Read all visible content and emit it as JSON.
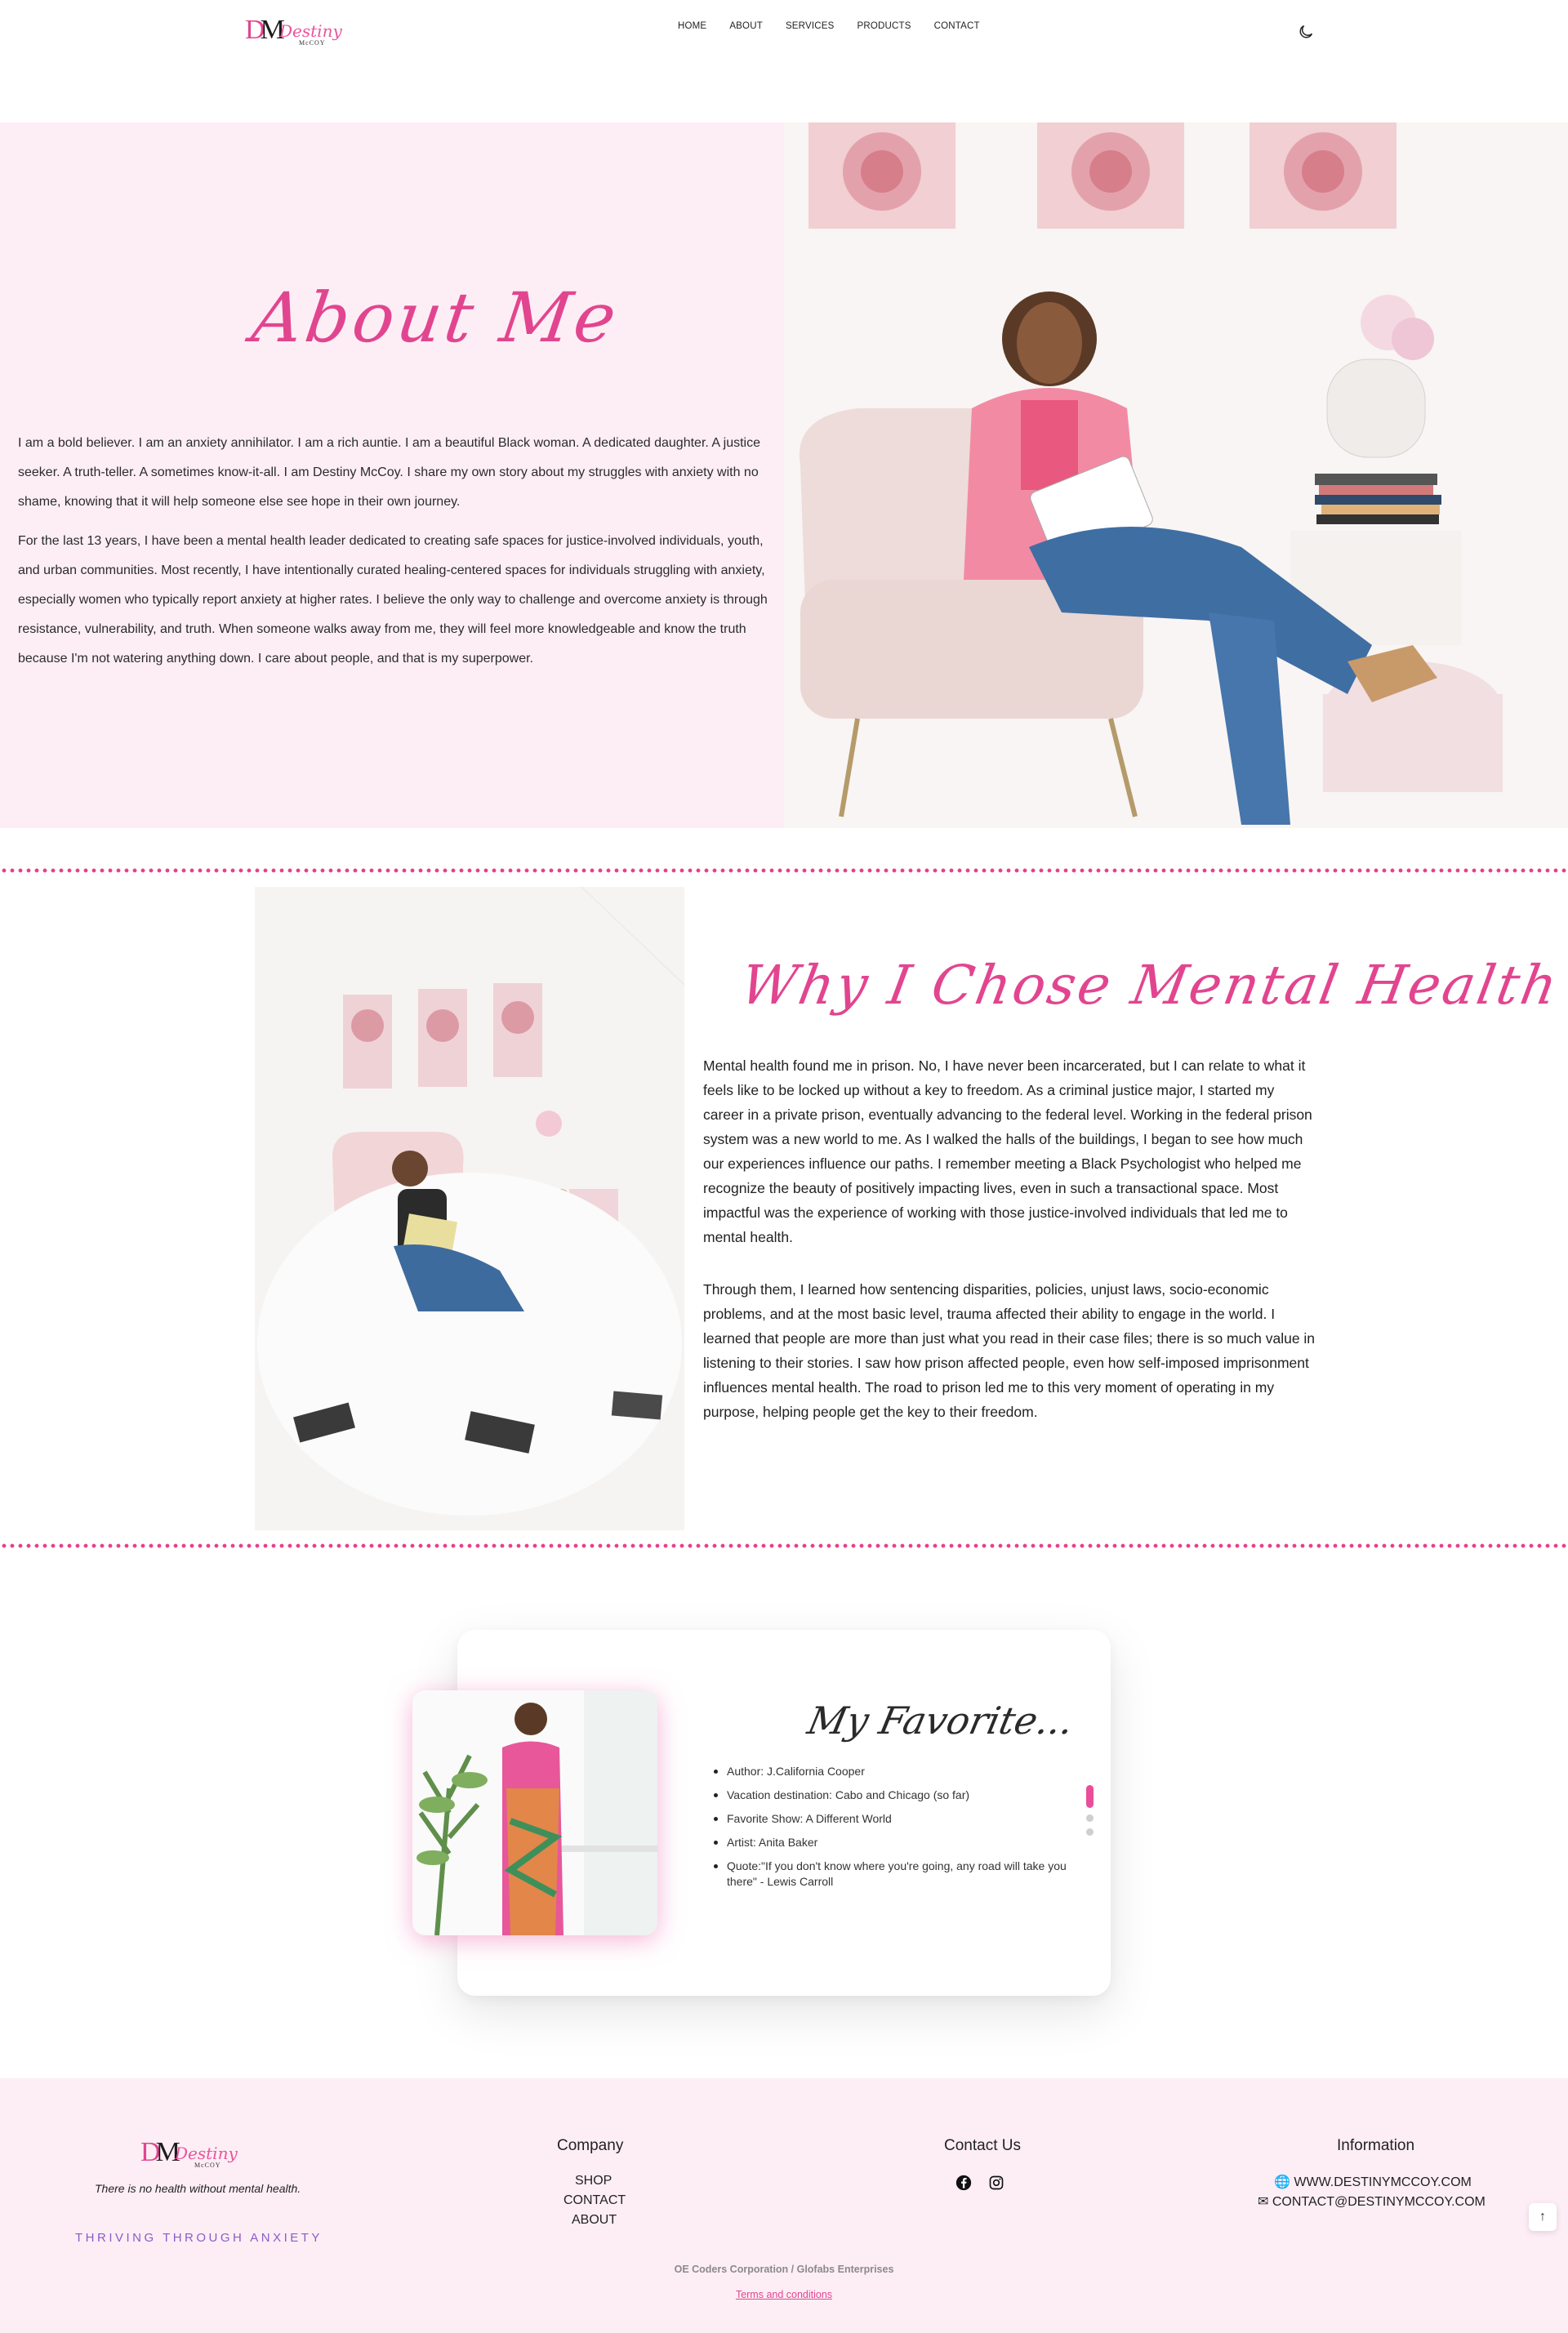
{
  "brand": {
    "monogram": "DM",
    "script_name": "Destiny",
    "sub_name": "McCOY"
  },
  "nav": {
    "items": [
      "HOME",
      "ABOUT",
      "SERVICES",
      "PRODUCTS",
      "CONTACT"
    ]
  },
  "about": {
    "title": "About Me",
    "paragraphs": [
      "I am a bold believer. I am an anxiety annihilator. I am a rich auntie. I am a beautiful Black woman. A dedicated daughter. A justice seeker. A truth-teller. A sometimes know-it-all. I am Destiny McCoy. I share my own story about my struggles with anxiety with no shame, knowing that it will help someone else see hope in their own journey.",
      "For the last 13 years, I have been a mental health leader dedicated to creating safe spaces for justice-involved individuals, youth, and urban communities. Most recently, I have intentionally curated healing-centered spaces for individuals struggling with anxiety, especially women who typically report anxiety at higher rates. I believe the only way to challenge and overcome anxiety is through resistance, vulnerability, and truth. When someone walks away from me, they will feel more knowledgeable and know the truth because I'm not watering anything down. I care about people, and that is my superpower."
    ]
  },
  "mental_health": {
    "title": "Why I Chose Mental Health",
    "paragraphs": [
      "Mental health found me in prison. No, I have never been incarcerated, but I can relate to what it feels like to be locked up without a key to freedom. As a criminal justice major, I started my career in a private prison, eventually advancing to the federal level. Working in the federal prison system was a new world to me. As I walked the halls of the buildings, I began to see how much our experiences influence our paths. I remember meeting a Black Psychologist who helped me recognize the beauty of positively impacting lives, even in such a transactional space. Most impactful was the experience of working with those justice-involved individuals that led me to mental health.",
      "Through them, I learned how sentencing disparities, policies, unjust laws, socio-economic problems, and at the most basic level, trauma affected their ability to engage in the world. I learned that people are more than just what you read in their case files; there is so much value in listening to their stories. I saw how prison affected people, even how self-imposed imprisonment influences mental health. The road to prison led me to this very moment of operating in my purpose, helping people get the key to their freedom."
    ]
  },
  "favorites": {
    "title": "My Favorite...",
    "items": [
      "Author: J.California Cooper",
      "Vacation destination: Cabo and Chicago (so far)",
      "Favorite Show: A Different World",
      "Artist: Anita Baker",
      "Quote:\"If you don't know where you're going, any road will take you there\" - Lewis Carroll"
    ],
    "slide_count": 3,
    "active_slide": 1
  },
  "footer": {
    "tagline": "There is no health without mental health.",
    "slogan": "THRIVING THROUGH ANXIETY",
    "company_title": "Company",
    "company_links": [
      "SHOP",
      "CONTACT",
      "ABOUT"
    ],
    "contact_title": "Contact Us",
    "social_icons": [
      "facebook-icon",
      "instagram-icon"
    ],
    "info_title": "Information",
    "website": "WWW.DESTINYMCCOY.COM",
    "email": "CONTACT@DESTINYMCCOY.COM",
    "copyright": "OE Coders Corporation / Glofabs Enterprises",
    "terms": "Terms and conditions",
    "scroll_top": "↑"
  },
  "colors": {
    "accent_pink": "#e2458f",
    "section_bg": "#fdeef5",
    "slogan_purple": "#8a5cc8"
  }
}
